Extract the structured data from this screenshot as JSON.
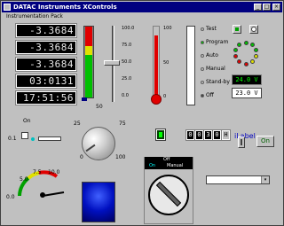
{
  "window": {
    "title": "DATAC Instruments XControls",
    "min_glyph": "_",
    "max_glyph": "□",
    "close_glyph": "×"
  },
  "group": {
    "label": "Instrumentation Pack"
  },
  "lcd_displays": [
    "-3.3684",
    "-3.3684",
    "-3.3684",
    "03:0131",
    "17:51:56"
  ],
  "bar_gauge": {
    "ticks": [
      "100.0",
      "75.0",
      "50.0",
      "25.0",
      "0.0"
    ],
    "segment_colors": [
      "#e00000",
      "#e0e000",
      "#00c000"
    ],
    "level_fraction": 0.72
  },
  "slider": {
    "value_fraction": 0.55
  },
  "thermometer": {
    "ticks": [
      "100",
      "50",
      "0"
    ],
    "level_fraction": 0.88
  },
  "modes": {
    "items": [
      "Test",
      "Program",
      "Auto",
      "Manual",
      "Stand-by",
      "Off"
    ],
    "colors": [
      "#c0c0c0",
      "#00c000",
      "#c0c0c0",
      "#c0c0c0",
      "#c0c0c0",
      "#404040"
    ]
  },
  "readouts": {
    "green": "24.0 V",
    "white": "23.0 V"
  },
  "led_ring_colors": [
    "#00c000",
    "#00c000",
    "#00c000",
    "#e0e000",
    "#e0e000",
    "#e00000",
    "#e00000",
    "#e00000",
    "#00c000",
    "#00c000"
  ],
  "left_controls": {
    "checkbox_label": "On",
    "small_label": "0.1"
  },
  "knob": {
    "labels": [
      "50",
      "25",
      "75",
      "0",
      "100"
    ]
  },
  "binary": {
    "digits": [
      "0",
      "0",
      "3",
      "0"
    ],
    "hex_label": "H"
  },
  "ilabel": {
    "text": "iLabel"
  },
  "meter": {
    "labels": [
      "0.0",
      "5.0",
      "7.5",
      "10.0"
    ]
  },
  "switch": {
    "title": "Off",
    "on_label": "On",
    "manual_label": "Manual"
  },
  "on_button": {
    "label": "On"
  },
  "combo": {
    "value": "",
    "arrow": "▾"
  }
}
